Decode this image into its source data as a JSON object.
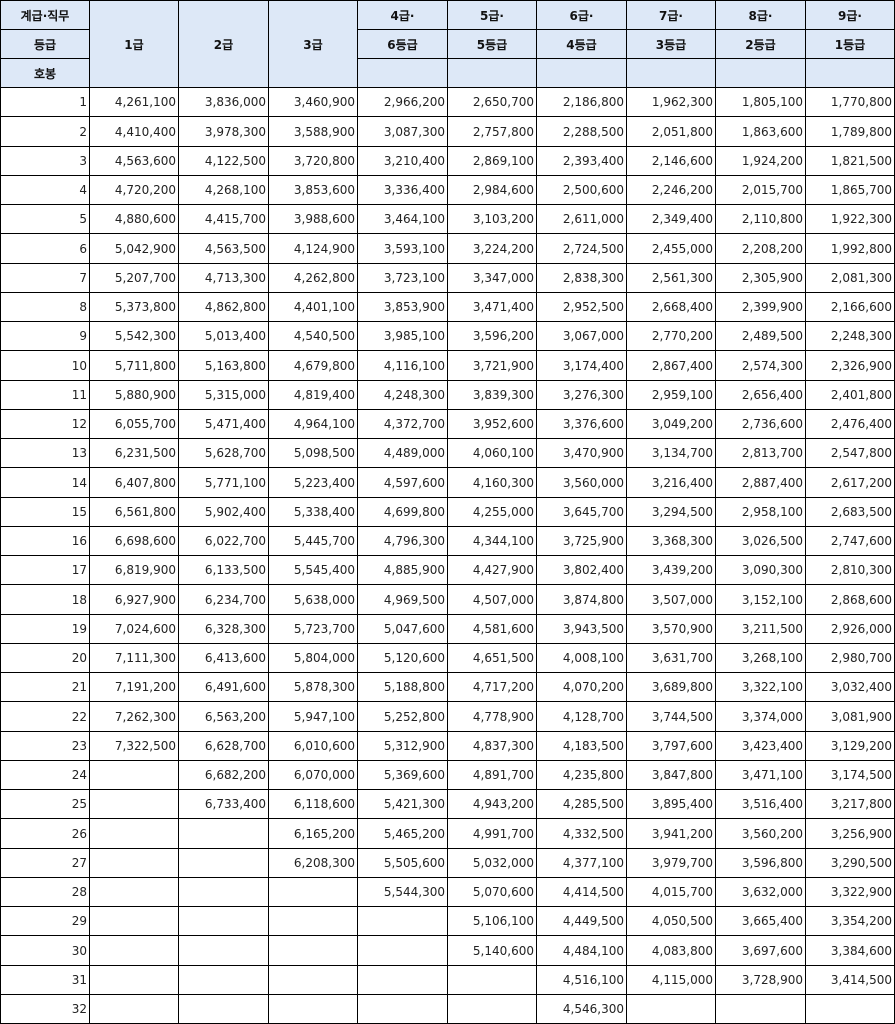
{
  "header": {
    "corner_labels": [
      "계급·직무",
      "등급",
      "호봉"
    ],
    "columns": [
      {
        "top": "",
        "bottom": "1급"
      },
      {
        "top": "",
        "bottom": "2급"
      },
      {
        "top": "",
        "bottom": "3급"
      },
      {
        "top": "4급·",
        "bottom": "6등급"
      },
      {
        "top": "5급·",
        "bottom": "5등급"
      },
      {
        "top": "6급·",
        "bottom": "4등급"
      },
      {
        "top": "7급·",
        "bottom": "3등급"
      },
      {
        "top": "8급·",
        "bottom": "2등급"
      },
      {
        "top": "9급·",
        "bottom": "1등급"
      }
    ]
  },
  "rows": [
    {
      "step": "1",
      "values": [
        "4,261,100",
        "3,836,000",
        "3,460,900",
        "2,966,200",
        "2,650,700",
        "2,186,800",
        "1,962,300",
        "1,805,100",
        "1,770,800"
      ]
    },
    {
      "step": "2",
      "values": [
        "4,410,400",
        "3,978,300",
        "3,588,900",
        "3,087,300",
        "2,757,800",
        "2,288,500",
        "2,051,800",
        "1,863,600",
        "1,789,800"
      ]
    },
    {
      "step": "3",
      "values": [
        "4,563,600",
        "4,122,500",
        "3,720,800",
        "3,210,400",
        "2,869,100",
        "2,393,400",
        "2,146,600",
        "1,924,200",
        "1,821,500"
      ]
    },
    {
      "step": "4",
      "values": [
        "4,720,200",
        "4,268,100",
        "3,853,600",
        "3,336,400",
        "2,984,600",
        "2,500,600",
        "2,246,200",
        "2,015,700",
        "1,865,700"
      ]
    },
    {
      "step": "5",
      "values": [
        "4,880,600",
        "4,415,700",
        "3,988,600",
        "3,464,100",
        "3,103,200",
        "2,611,000",
        "2,349,400",
        "2,110,800",
        "1,922,300"
      ]
    },
    {
      "step": "6",
      "values": [
        "5,042,900",
        "4,563,500",
        "4,124,900",
        "3,593,100",
        "3,224,200",
        "2,724,500",
        "2,455,000",
        "2,208,200",
        "1,992,800"
      ]
    },
    {
      "step": "7",
      "values": [
        "5,207,700",
        "4,713,300",
        "4,262,800",
        "3,723,100",
        "3,347,000",
        "2,838,300",
        "2,561,300",
        "2,305,900",
        "2,081,300"
      ]
    },
    {
      "step": "8",
      "values": [
        "5,373,800",
        "4,862,800",
        "4,401,100",
        "3,853,900",
        "3,471,400",
        "2,952,500",
        "2,668,400",
        "2,399,900",
        "2,166,600"
      ]
    },
    {
      "step": "9",
      "values": [
        "5,542,300",
        "5,013,400",
        "4,540,500",
        "3,985,100",
        "3,596,200",
        "3,067,000",
        "2,770,200",
        "2,489,500",
        "2,248,300"
      ]
    },
    {
      "step": "10",
      "values": [
        "5,711,800",
        "5,163,800",
        "4,679,800",
        "4,116,100",
        "3,721,900",
        "3,174,400",
        "2,867,400",
        "2,574,300",
        "2,326,900"
      ]
    },
    {
      "step": "11",
      "values": [
        "5,880,900",
        "5,315,000",
        "4,819,400",
        "4,248,300",
        "3,839,300",
        "3,276,300",
        "2,959,100",
        "2,656,400",
        "2,401,800"
      ]
    },
    {
      "step": "12",
      "values": [
        "6,055,700",
        "5,471,400",
        "4,964,100",
        "4,372,700",
        "3,952,600",
        "3,376,600",
        "3,049,200",
        "2,736,600",
        "2,476,400"
      ]
    },
    {
      "step": "13",
      "values": [
        "6,231,500",
        "5,628,700",
        "5,098,500",
        "4,489,000",
        "4,060,100",
        "3,470,900",
        "3,134,700",
        "2,813,700",
        "2,547,800"
      ]
    },
    {
      "step": "14",
      "values": [
        "6,407,800",
        "5,771,100",
        "5,223,400",
        "4,597,600",
        "4,160,300",
        "3,560,000",
        "3,216,400",
        "2,887,400",
        "2,617,200"
      ]
    },
    {
      "step": "15",
      "values": [
        "6,561,800",
        "5,902,400",
        "5,338,400",
        "4,699,800",
        "4,255,000",
        "3,645,700",
        "3,294,500",
        "2,958,100",
        "2,683,500"
      ]
    },
    {
      "step": "16",
      "values": [
        "6,698,600",
        "6,022,700",
        "5,445,700",
        "4,796,300",
        "4,344,100",
        "3,725,900",
        "3,368,300",
        "3,026,500",
        "2,747,600"
      ]
    },
    {
      "step": "17",
      "values": [
        "6,819,900",
        "6,133,500",
        "5,545,400",
        "4,885,900",
        "4,427,900",
        "3,802,400",
        "3,439,200",
        "3,090,300",
        "2,810,300"
      ]
    },
    {
      "step": "18",
      "values": [
        "6,927,900",
        "6,234,700",
        "5,638,000",
        "4,969,500",
        "4,507,000",
        "3,874,800",
        "3,507,000",
        "3,152,100",
        "2,868,600"
      ]
    },
    {
      "step": "19",
      "values": [
        "7,024,600",
        "6,328,300",
        "5,723,700",
        "5,047,600",
        "4,581,600",
        "3,943,500",
        "3,570,900",
        "3,211,500",
        "2,926,000"
      ]
    },
    {
      "step": "20",
      "values": [
        "7,111,300",
        "6,413,600",
        "5,804,000",
        "5,120,600",
        "4,651,500",
        "4,008,100",
        "3,631,700",
        "3,268,100",
        "2,980,700"
      ]
    },
    {
      "step": "21",
      "values": [
        "7,191,200",
        "6,491,600",
        "5,878,300",
        "5,188,800",
        "4,717,200",
        "4,070,200",
        "3,689,800",
        "3,322,100",
        "3,032,400"
      ]
    },
    {
      "step": "22",
      "values": [
        "7,262,300",
        "6,563,200",
        "5,947,100",
        "5,252,800",
        "4,778,900",
        "4,128,700",
        "3,744,500",
        "3,374,000",
        "3,081,900"
      ]
    },
    {
      "step": "23",
      "values": [
        "7,322,500",
        "6,628,700",
        "6,010,600",
        "5,312,900",
        "4,837,300",
        "4,183,500",
        "3,797,600",
        "3,423,400",
        "3,129,200"
      ]
    },
    {
      "step": "24",
      "values": [
        "",
        "6,682,200",
        "6,070,000",
        "5,369,600",
        "4,891,700",
        "4,235,800",
        "3,847,800",
        "3,471,100",
        "3,174,500"
      ]
    },
    {
      "step": "25",
      "values": [
        "",
        "6,733,400",
        "6,118,600",
        "5,421,300",
        "4,943,200",
        "4,285,500",
        "3,895,400",
        "3,516,400",
        "3,217,800"
      ]
    },
    {
      "step": "26",
      "values": [
        "",
        "",
        "6,165,200",
        "5,465,200",
        "4,991,700",
        "4,332,500",
        "3,941,200",
        "3,560,200",
        "3,256,900"
      ]
    },
    {
      "step": "27",
      "values": [
        "",
        "",
        "6,208,300",
        "5,505,600",
        "5,032,000",
        "4,377,100",
        "3,979,700",
        "3,596,800",
        "3,290,500"
      ]
    },
    {
      "step": "28",
      "values": [
        "",
        "",
        "",
        "5,544,300",
        "5,070,600",
        "4,414,500",
        "4,015,700",
        "3,632,000",
        "3,322,900"
      ]
    },
    {
      "step": "29",
      "values": [
        "",
        "",
        "",
        "",
        "5,106,100",
        "4,449,500",
        "4,050,500",
        "3,665,400",
        "3,354,200"
      ]
    },
    {
      "step": "30",
      "values": [
        "",
        "",
        "",
        "",
        "5,140,600",
        "4,484,100",
        "4,083,800",
        "3,697,600",
        "3,384,600"
      ]
    },
    {
      "step": "31",
      "values": [
        "",
        "",
        "",
        "",
        "",
        "4,516,100",
        "4,115,000",
        "3,728,900",
        "3,414,500"
      ]
    },
    {
      "step": "32",
      "values": [
        "",
        "",
        "",
        "",
        "",
        "4,546,300",
        "",
        "",
        ""
      ]
    }
  ]
}
